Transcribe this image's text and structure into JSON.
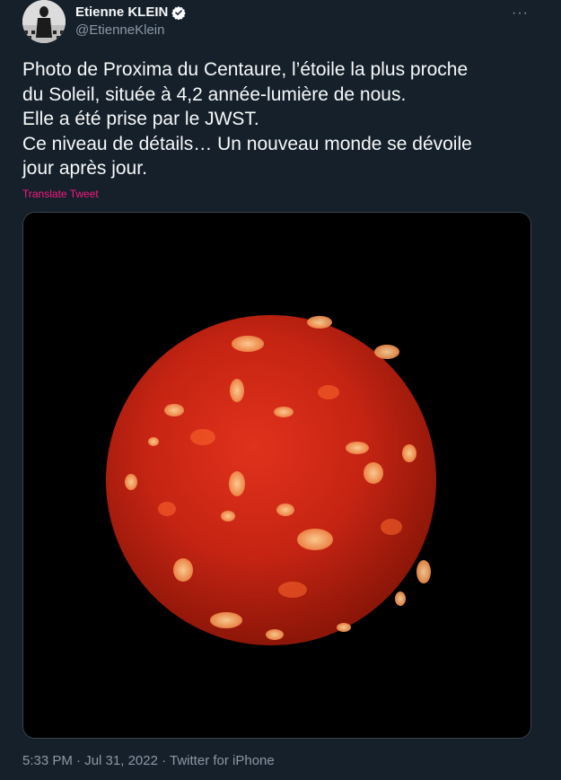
{
  "author": {
    "display_name": "Etienne KLEIN",
    "handle": "@EtienneKlein",
    "avatar_icon": "avatar-photo",
    "verified_icon": "verified-badge-icon"
  },
  "menu": {
    "more_label": "···"
  },
  "tweet": {
    "lines": [
      "Photo de Proxima du Centaure, l’étoile la plus proche",
      "du Soleil, située à 4,2 année-lumière de nous.",
      "Elle a été prise par le JWST.",
      "Ce niveau de détails… Un nouveau monde se dévoile",
      "jour après jour."
    ],
    "translate_label": "Translate Tweet"
  },
  "media": {
    "subject": "red-sphere-image"
  },
  "meta": {
    "time": "5:33 PM",
    "sep1": " · ",
    "date": "Jul 31, 2022",
    "sep2": " · ",
    "app": "Twitter for iPhone"
  },
  "colors": {
    "background": "#15202b",
    "text": "#f7f9f9",
    "secondary": "#8b98a5",
    "link": "#f91880",
    "verified": "#ffffff"
  }
}
